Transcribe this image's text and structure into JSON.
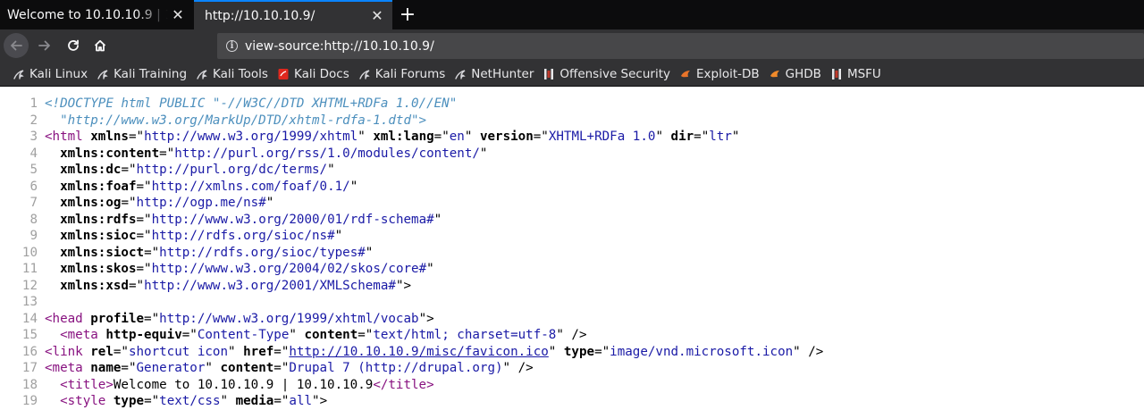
{
  "tabs": [
    {
      "title": "Welcome to 10.10.10.9 | 10.10.10.9",
      "active": false
    },
    {
      "title": "http://10.10.10.9/",
      "active": true
    }
  ],
  "navbar": {
    "url": "view-source:http://10.10.10.9/"
  },
  "bookmarks": [
    {
      "label": "Kali Linux",
      "icon": "kali-dragon-icon"
    },
    {
      "label": "Kali Training",
      "icon": "kali-dragon-icon"
    },
    {
      "label": "Kali Tools",
      "icon": "kali-dragon-icon"
    },
    {
      "label": "Kali Docs",
      "icon": "kali-docs-icon"
    },
    {
      "label": "Kali Forums",
      "icon": "kali-dragon-icon"
    },
    {
      "label": "NetHunter",
      "icon": "kali-dragon-icon"
    },
    {
      "label": "Offensive Security",
      "icon": "offsec-icon"
    },
    {
      "label": "Exploit-DB",
      "icon": "exploit-db-icon"
    },
    {
      "label": "GHDB",
      "icon": "ghdb-icon"
    },
    {
      "label": "MSFU",
      "icon": "offsec-icon"
    }
  ],
  "source": {
    "lines": [
      {
        "n": "1",
        "parts": [
          {
            "t": "doctype",
            "v": "<!DOCTYPE html PUBLIC \"-//W3C//DTD XHTML+RDFa 1.0//EN\""
          }
        ]
      },
      {
        "n": "2",
        "parts": [
          {
            "t": "doctype",
            "v": "  \"http://www.w3.org/MarkUp/DTD/xhtml-rdfa-1.dtd\">"
          }
        ]
      },
      {
        "n": "3",
        "parts": [
          {
            "t": "tag",
            "v": "<html "
          },
          {
            "t": "attr",
            "v": "xmlns"
          },
          {
            "t": "txt",
            "v": "=\""
          },
          {
            "t": "val",
            "v": "http://www.w3.org/1999/xhtml"
          },
          {
            "t": "txt",
            "v": "\" "
          },
          {
            "t": "attr",
            "v": "xml:lang"
          },
          {
            "t": "txt",
            "v": "=\""
          },
          {
            "t": "val",
            "v": "en"
          },
          {
            "t": "txt",
            "v": "\" "
          },
          {
            "t": "attr",
            "v": "version"
          },
          {
            "t": "txt",
            "v": "=\""
          },
          {
            "t": "val",
            "v": "XHTML+RDFa 1.0"
          },
          {
            "t": "txt",
            "v": "\" "
          },
          {
            "t": "attr",
            "v": "dir"
          },
          {
            "t": "txt",
            "v": "=\""
          },
          {
            "t": "val",
            "v": "ltr"
          },
          {
            "t": "txt",
            "v": "\""
          }
        ]
      },
      {
        "n": "4",
        "parts": [
          {
            "t": "txt",
            "v": "  "
          },
          {
            "t": "attr",
            "v": "xmlns:content"
          },
          {
            "t": "txt",
            "v": "=\""
          },
          {
            "t": "val",
            "v": "http://purl.org/rss/1.0/modules/content/"
          },
          {
            "t": "txt",
            "v": "\""
          }
        ]
      },
      {
        "n": "5",
        "parts": [
          {
            "t": "txt",
            "v": "  "
          },
          {
            "t": "attr",
            "v": "xmlns:dc"
          },
          {
            "t": "txt",
            "v": "=\""
          },
          {
            "t": "val",
            "v": "http://purl.org/dc/terms/"
          },
          {
            "t": "txt",
            "v": "\""
          }
        ]
      },
      {
        "n": "6",
        "parts": [
          {
            "t": "txt",
            "v": "  "
          },
          {
            "t": "attr",
            "v": "xmlns:foaf"
          },
          {
            "t": "txt",
            "v": "=\""
          },
          {
            "t": "val",
            "v": "http://xmlns.com/foaf/0.1/"
          },
          {
            "t": "txt",
            "v": "\""
          }
        ]
      },
      {
        "n": "7",
        "parts": [
          {
            "t": "txt",
            "v": "  "
          },
          {
            "t": "attr",
            "v": "xmlns:og"
          },
          {
            "t": "txt",
            "v": "=\""
          },
          {
            "t": "val",
            "v": "http://ogp.me/ns#"
          },
          {
            "t": "txt",
            "v": "\""
          }
        ]
      },
      {
        "n": "8",
        "parts": [
          {
            "t": "txt",
            "v": "  "
          },
          {
            "t": "attr",
            "v": "xmlns:rdfs"
          },
          {
            "t": "txt",
            "v": "=\""
          },
          {
            "t": "val",
            "v": "http://www.w3.org/2000/01/rdf-schema#"
          },
          {
            "t": "txt",
            "v": "\""
          }
        ]
      },
      {
        "n": "9",
        "parts": [
          {
            "t": "txt",
            "v": "  "
          },
          {
            "t": "attr",
            "v": "xmlns:sioc"
          },
          {
            "t": "txt",
            "v": "=\""
          },
          {
            "t": "val",
            "v": "http://rdfs.org/sioc/ns#"
          },
          {
            "t": "txt",
            "v": "\""
          }
        ]
      },
      {
        "n": "10",
        "parts": [
          {
            "t": "txt",
            "v": "  "
          },
          {
            "t": "attr",
            "v": "xmlns:sioct"
          },
          {
            "t": "txt",
            "v": "=\""
          },
          {
            "t": "val",
            "v": "http://rdfs.org/sioc/types#"
          },
          {
            "t": "txt",
            "v": "\""
          }
        ]
      },
      {
        "n": "11",
        "parts": [
          {
            "t": "txt",
            "v": "  "
          },
          {
            "t": "attr",
            "v": "xmlns:skos"
          },
          {
            "t": "txt",
            "v": "=\""
          },
          {
            "t": "val",
            "v": "http://www.w3.org/2004/02/skos/core#"
          },
          {
            "t": "txt",
            "v": "\""
          }
        ]
      },
      {
        "n": "12",
        "parts": [
          {
            "t": "txt",
            "v": "  "
          },
          {
            "t": "attr",
            "v": "xmlns:xsd"
          },
          {
            "t": "txt",
            "v": "=\""
          },
          {
            "t": "val",
            "v": "http://www.w3.org/2001/XMLSchema#"
          },
          {
            "t": "txt",
            "v": "\">"
          }
        ]
      },
      {
        "n": "13",
        "parts": []
      },
      {
        "n": "14",
        "parts": [
          {
            "t": "tag",
            "v": "<head "
          },
          {
            "t": "attr",
            "v": "profile"
          },
          {
            "t": "txt",
            "v": "=\""
          },
          {
            "t": "val",
            "v": "http://www.w3.org/1999/xhtml/vocab"
          },
          {
            "t": "txt",
            "v": "\">"
          }
        ]
      },
      {
        "n": "15",
        "parts": [
          {
            "t": "txt",
            "v": "  "
          },
          {
            "t": "tag",
            "v": "<meta "
          },
          {
            "t": "attr",
            "v": "http-equiv"
          },
          {
            "t": "txt",
            "v": "=\""
          },
          {
            "t": "val",
            "v": "Content-Type"
          },
          {
            "t": "txt",
            "v": "\" "
          },
          {
            "t": "attr",
            "v": "content"
          },
          {
            "t": "txt",
            "v": "=\""
          },
          {
            "t": "val",
            "v": "text/html; charset=utf-8"
          },
          {
            "t": "txt",
            "v": "\" />"
          }
        ]
      },
      {
        "n": "16",
        "parts": [
          {
            "t": "tag",
            "v": "<link "
          },
          {
            "t": "attr",
            "v": "rel"
          },
          {
            "t": "txt",
            "v": "=\""
          },
          {
            "t": "val",
            "v": "shortcut icon"
          },
          {
            "t": "txt",
            "v": "\" "
          },
          {
            "t": "attr",
            "v": "href"
          },
          {
            "t": "txt",
            "v": "=\""
          },
          {
            "t": "link",
            "v": "http://10.10.10.9/misc/favicon.ico"
          },
          {
            "t": "txt",
            "v": "\" "
          },
          {
            "t": "attr",
            "v": "type"
          },
          {
            "t": "txt",
            "v": "=\""
          },
          {
            "t": "val",
            "v": "image/vnd.microsoft.icon"
          },
          {
            "t": "txt",
            "v": "\" />"
          }
        ]
      },
      {
        "n": "17",
        "parts": [
          {
            "t": "tag",
            "v": "<meta "
          },
          {
            "t": "attr",
            "v": "name"
          },
          {
            "t": "txt",
            "v": "=\""
          },
          {
            "t": "val",
            "v": "Generator"
          },
          {
            "t": "txt",
            "v": "\" "
          },
          {
            "t": "attr",
            "v": "content"
          },
          {
            "t": "txt",
            "v": "=\""
          },
          {
            "t": "val",
            "v": "Drupal 7 (http://drupal.org)"
          },
          {
            "t": "txt",
            "v": "\" />"
          }
        ]
      },
      {
        "n": "18",
        "parts": [
          {
            "t": "txt",
            "v": "  "
          },
          {
            "t": "tag",
            "v": "<title>"
          },
          {
            "t": "txt",
            "v": "Welcome to 10.10.10.9 | 10.10.10.9"
          },
          {
            "t": "tag",
            "v": "</title>"
          }
        ]
      },
      {
        "n": "19",
        "parts": [
          {
            "t": "txt",
            "v": "  "
          },
          {
            "t": "tag",
            "v": "<style "
          },
          {
            "t": "attr",
            "v": "type"
          },
          {
            "t": "txt",
            "v": "=\""
          },
          {
            "t": "val",
            "v": "text/css"
          },
          {
            "t": "txt",
            "v": "\" "
          },
          {
            "t": "attr",
            "v": "media"
          },
          {
            "t": "txt",
            "v": "=\""
          },
          {
            "t": "val",
            "v": "all"
          },
          {
            "t": "txt",
            "v": "\">"
          }
        ]
      }
    ]
  }
}
